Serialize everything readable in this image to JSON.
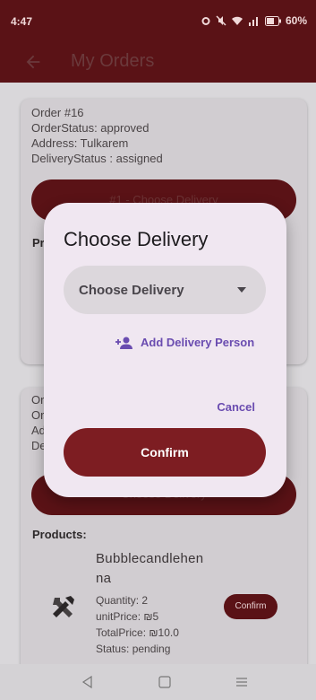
{
  "status_bar": {
    "time": "4:47",
    "battery": "60%"
  },
  "app_bar": {
    "title": "My Orders"
  },
  "orders": [
    {
      "lines": [
        "Order #16",
        "OrderStatus: approved",
        "Address: Tulkarem",
        "DeliveryStatus : assigned"
      ],
      "choose_delivery_label": "#1 - Choose Delivery",
      "products_label": "Pr"
    },
    {
      "lines": [
        "Or",
        "Or",
        "Ad",
        "De"
      ],
      "choose_delivery_label": "Choose Delivery",
      "products_label": "Products:",
      "product": {
        "name_line1": "Bubblecandlehen",
        "name_line2": "na",
        "quantity": "Quantity: 2",
        "unit_price": "unitPrice: ₪5",
        "total_price": "TotalPrice: ₪10.0",
        "status": "Status: pending",
        "confirm_label": "Confirm",
        "icon": "tools-icon"
      }
    }
  ],
  "dialog": {
    "title": "Choose Delivery",
    "dropdown_value": "Choose Delivery",
    "add_delivery_label": "Add Delivery Person",
    "cancel_label": "Cancel",
    "confirm_label": "Confirm"
  },
  "colors": {
    "primary": "#7d1d22",
    "accent": "#6a4cb0",
    "dialog_bg": "#f0e7f1"
  }
}
